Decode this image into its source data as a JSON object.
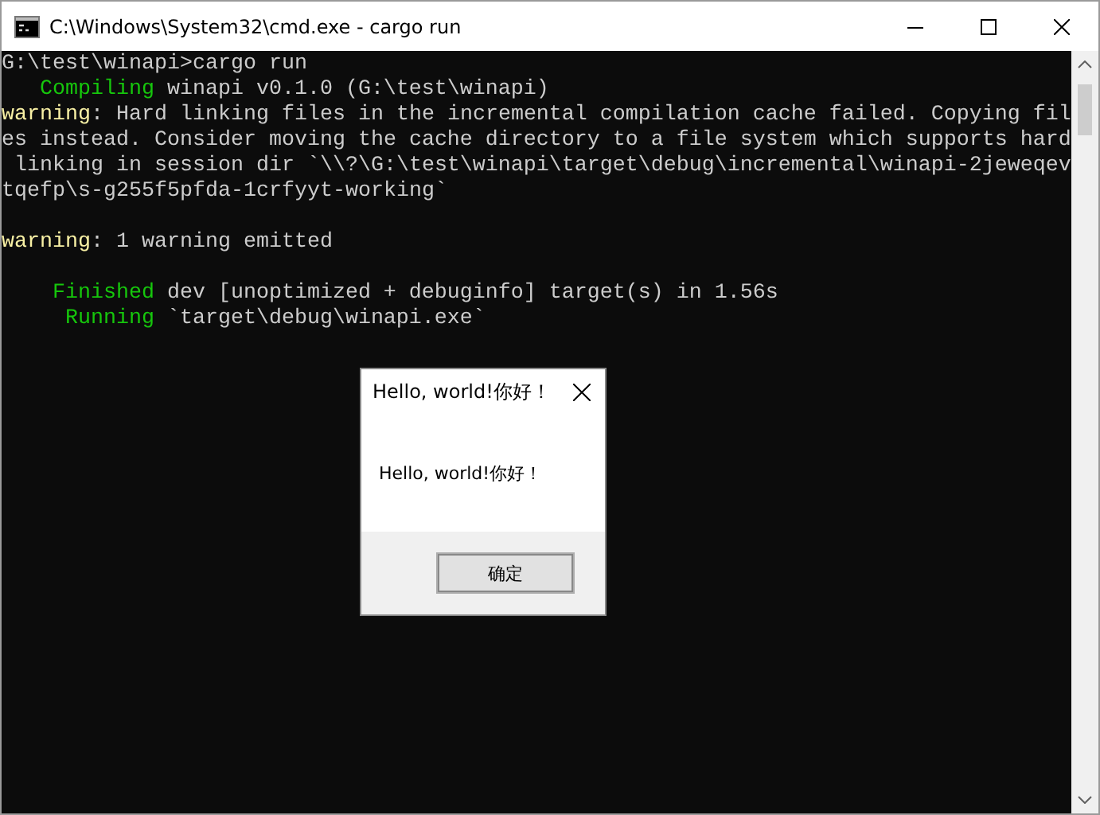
{
  "window": {
    "title": "C:\\Windows\\System32\\cmd.exe - cargo  run"
  },
  "console": {
    "blocks": [
      {
        "lines": [
          [
            {
              "kind": "plain",
              "text": "G:\\test\\winapi>cargo run"
            }
          ],
          [
            {
              "kind": "status",
              "text": "Compiling"
            },
            {
              "kind": "plain",
              "text": " winapi v0.1.0 (G:\\test\\winapi)"
            }
          ],
          [
            {
              "kind": "warning",
              "text": "warning"
            },
            {
              "kind": "plain",
              "text": ": Hard linking files in the incremental compilation cache failed. Copying fil"
            }
          ],
          [
            {
              "kind": "plain",
              "text": "es instead. Consider moving the cache directory to a file system which supports hard"
            }
          ],
          [
            {
              "kind": "plain",
              "text": " linking in session dir `\\\\?\\G:\\test\\winapi\\target\\debug\\incremental\\winapi-2jeweqev"
            }
          ],
          [
            {
              "kind": "plain",
              "text": "tqefp\\s-g255f5pfda-1crfyyt-working`"
            }
          ]
        ]
      },
      {
        "lines": [
          [
            {
              "kind": "warning",
              "text": "warning"
            },
            {
              "kind": "plain",
              "text": ": 1 warning emitted"
            }
          ]
        ]
      },
      {
        "lines": [
          [
            {
              "kind": "status",
              "text": "Finished"
            },
            {
              "kind": "plain",
              "text": " dev [unoptimized + debuginfo] target(s) in 1.56s"
            }
          ],
          [
            {
              "kind": "status",
              "text": "Running"
            },
            {
              "kind": "plain",
              "text": " `target\\debug\\winapi.exe`"
            }
          ]
        ]
      }
    ]
  },
  "dialog": {
    "title": "Hello, world!你好！",
    "message": "Hello, world!你好！",
    "buttons": [
      "确定"
    ]
  }
}
